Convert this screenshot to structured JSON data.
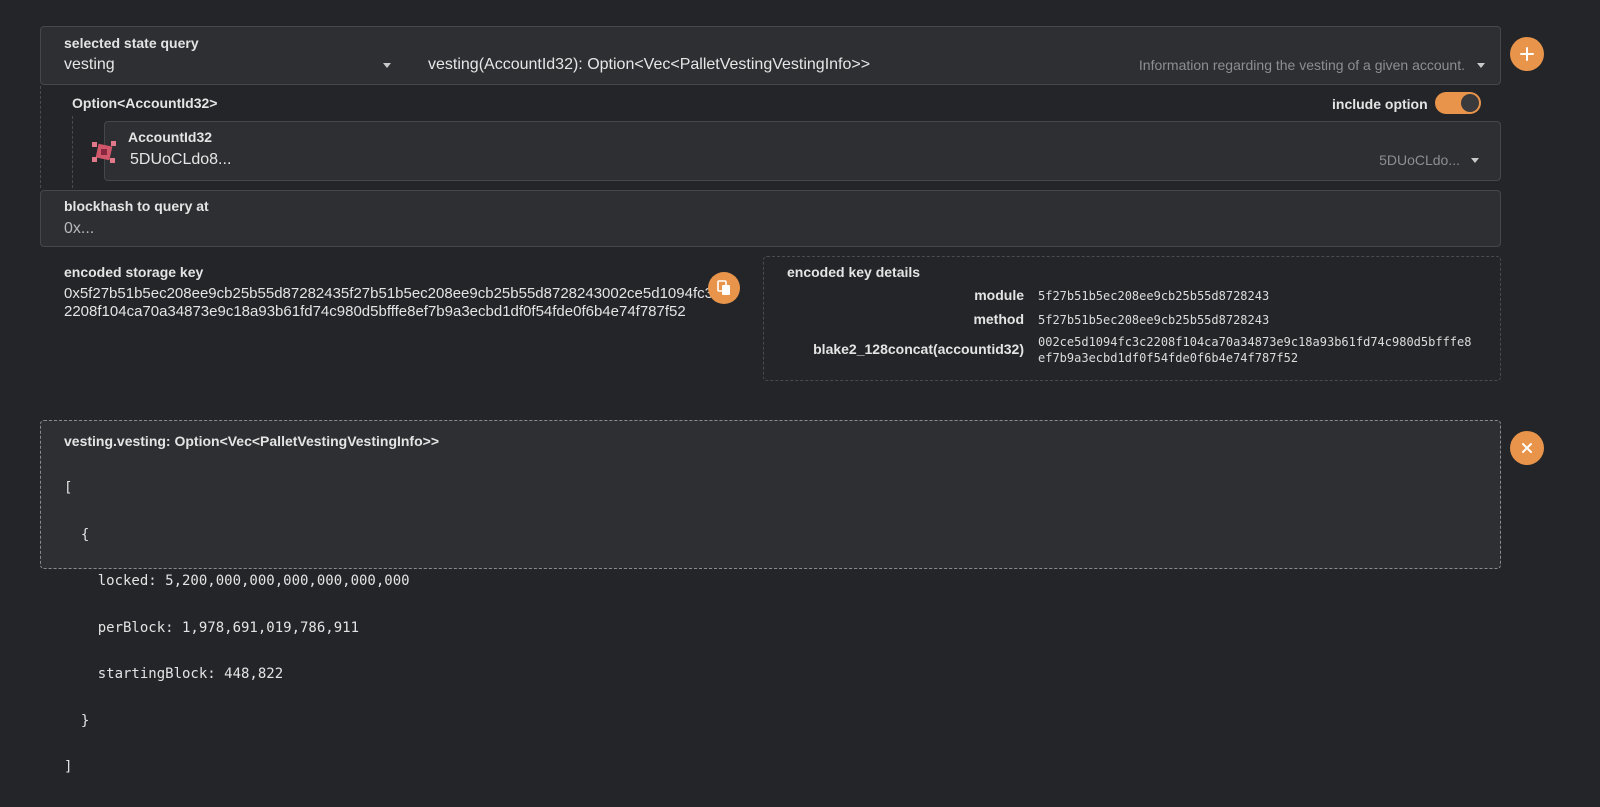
{
  "query": {
    "label": "selected state query",
    "section_value": "vesting",
    "signature": "vesting(AccountId32): Option<Vec<PalletVestingVestingInfo>>",
    "description": "Information regarding the vesting of a given account."
  },
  "option": {
    "label": "Option<AccountId32>",
    "include_label": "include option",
    "include_enabled": true
  },
  "account": {
    "label": "AccountId32",
    "value": "5DUoCLdo8...",
    "short_value": "5DUoCLdo..."
  },
  "blockhash": {
    "label": "blockhash to query at",
    "placeholder": "0x..."
  },
  "encoded_key": {
    "label": "encoded storage key",
    "value": "0x5f27b51b5ec208ee9cb25b55d87282435f27b51b5ec208ee9cb25b55d8728243002ce5d1094fc3c2208f104ca70a34873e9c18a93b61fd74c980d5bfffe8ef7b9a3ecbd1df0f54fde0f6b4e74f787f52"
  },
  "key_details": {
    "label": "encoded key details",
    "rows": [
      {
        "key": "module",
        "value": "5f27b51b5ec208ee9cb25b55d8728243"
      },
      {
        "key": "method",
        "value": "5f27b51b5ec208ee9cb25b55d8728243"
      },
      {
        "key": "blake2_128concat(accountid32)",
        "value": "002ce5d1094fc3c2208f104ca70a34873e9c18a93b61fd74c980d5bfffe8ef7b9a3ecbd1df0f54fde0f6b4e74f787f52"
      }
    ]
  },
  "result": {
    "label": "vesting.vesting: Option<Vec<PalletVestingVestingInfo>>",
    "lines": [
      "[",
      "  {",
      "    locked: 5,200,000,000,000,000,000,000",
      "    perBlock: 1,978,691,019,786,911",
      "    startingBlock: 448,822",
      "  }",
      "]"
    ]
  },
  "colors": {
    "accent": "#e8944a",
    "background": "#242529",
    "panel": "#2e2f33"
  },
  "icons": {
    "add": "plus-icon",
    "close": "close-icon",
    "copy": "copy-icon",
    "identicon": "account-identicon"
  }
}
